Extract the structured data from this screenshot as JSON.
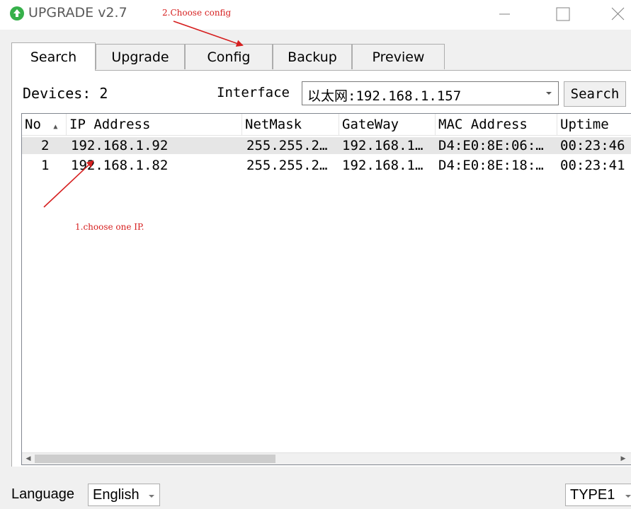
{
  "window": {
    "title": "UPGRADE v2.7",
    "minimize_icon": "minimize-icon",
    "maximize_icon": "maximize-icon",
    "close_icon": "close-icon",
    "logo_icon": "upload-arrow-icon",
    "logo_color": "#36b04a"
  },
  "annotations": {
    "step2": "2.Choose config",
    "step1": "1.choose one IP.",
    "color": "#d62020"
  },
  "tabs": [
    {
      "label": "Search",
      "active": true
    },
    {
      "label": "Upgrade",
      "active": false
    },
    {
      "label": "Config",
      "active": false
    },
    {
      "label": "Backup",
      "active": false
    },
    {
      "label": "Preview",
      "active": false
    }
  ],
  "search_panel": {
    "devices_label": "Devices: 2",
    "interface_label": "Interface",
    "interface_value": "以太网:192.168.1.157",
    "search_button": "Search"
  },
  "table": {
    "columns": [
      "No",
      "IP Address",
      "NetMask",
      "GateWay",
      "MAC Address",
      "Uptime"
    ],
    "sort_icon": "sort-up-icon",
    "rows": [
      {
        "no": "2",
        "ip": "192.168.1.92",
        "netmask": "255.255.2…",
        "gateway": "192.168.1…",
        "mac": "D4:E0:8E:06:…",
        "uptime": "00:23:46",
        "selected": true
      },
      {
        "no": "1",
        "ip": "192.168.1.82",
        "netmask": "255.255.2…",
        "gateway": "192.168.1…",
        "mac": "D4:E0:8E:18:…",
        "uptime": "00:23:41",
        "selected": false
      }
    ]
  },
  "footer": {
    "language_label": "Language",
    "language_value": "English",
    "type_value": "TYPE1"
  }
}
